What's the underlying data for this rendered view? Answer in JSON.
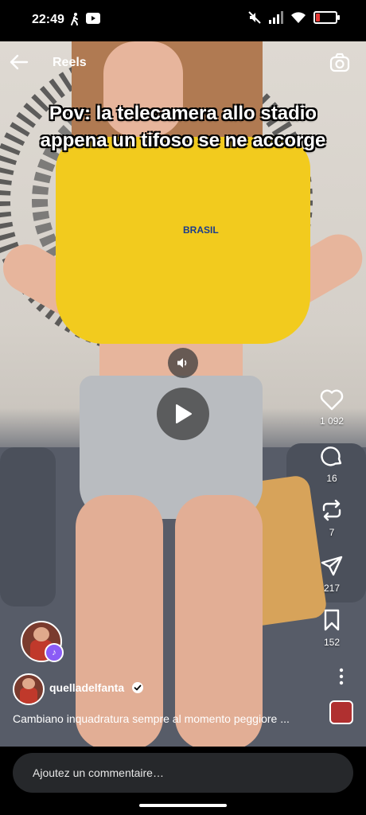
{
  "status_bar": {
    "time": "22:49"
  },
  "header": {
    "title": "Reels"
  },
  "video": {
    "overlay_text_line1": "Pov: la telecamera allo stadio",
    "overlay_text_line2": "appena un tifoso se ne accorge",
    "jersey_text": "BRASIL"
  },
  "actions": {
    "likes": "1 092",
    "comments": "16",
    "reposts": "7",
    "shares": "217",
    "saves": "152"
  },
  "post": {
    "username": "quelladelfanta",
    "caption": "Cambiano inquadratura sempre al momento peggiore ..."
  },
  "comment_box": {
    "placeholder": "Ajoutez un commentaire…"
  },
  "colors": {
    "background": "#000000",
    "battery_low": "#e53935",
    "collab_badge": "#8b5cf6"
  }
}
